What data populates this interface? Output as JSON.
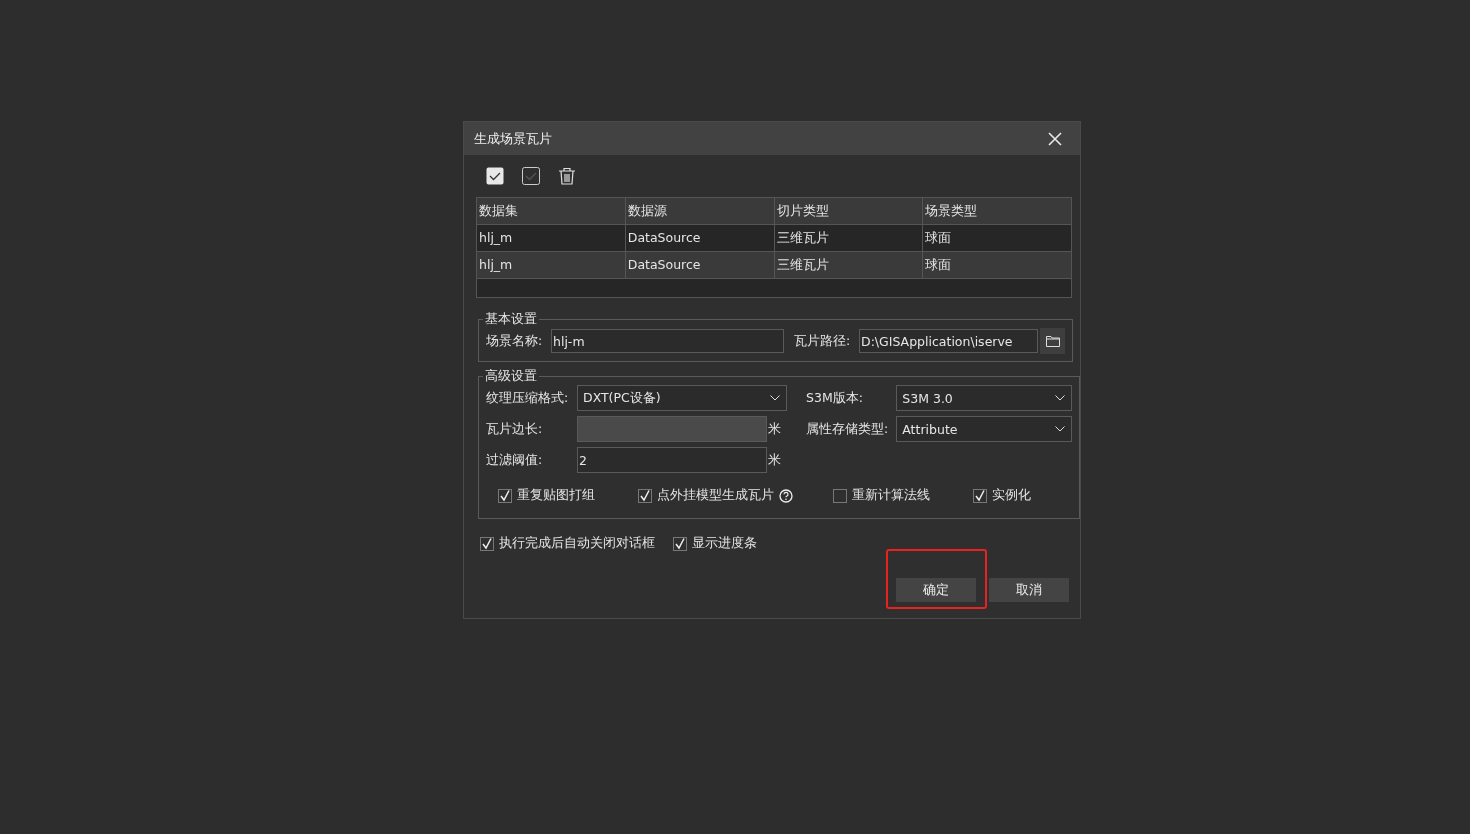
{
  "window": {
    "title": "生成场景瓦片"
  },
  "table": {
    "columns": [
      "数据集",
      "数据源",
      "切片类型",
      "场景类型"
    ],
    "rows": [
      [
        "hlj_m",
        "DataSource",
        "三维瓦片",
        "球面"
      ],
      [
        "hlj_m",
        "DataSource",
        "三维瓦片",
        "球面"
      ]
    ]
  },
  "basic_settings": {
    "legend": "基本设置",
    "scene_name": {
      "label": "场景名称:",
      "value": "hlj-m"
    },
    "tile_path": {
      "label": "瓦片路径:",
      "value": "D:\\GISApplication\\iserve"
    }
  },
  "advanced_settings": {
    "legend": "高级设置",
    "fields": [
      {
        "kind": "dropdown",
        "label": "纹理压缩格式:",
        "value": "DXT(PC设备)"
      },
      {
        "kind": "dropdown",
        "label": "S3M版本:",
        "value": "S3M 3.0"
      },
      {
        "kind": "input",
        "label": "瓦片边长:",
        "disabled": true,
        "unit": "米"
      },
      {
        "kind": "dropdown",
        "label": "属性存储类型:",
        "value": "Attribute"
      },
      {
        "kind": "input",
        "label": "过滤阈值:",
        "value": "2",
        "disabled": false,
        "unit": "米"
      }
    ],
    "options": [
      {
        "label": "重复贴图打组",
        "checked": true,
        "help": false
      },
      {
        "label": "点外挂模型生成瓦片",
        "checked": true,
        "help": true
      },
      {
        "label": "重新计算法线",
        "checked": false,
        "help": false
      },
      {
        "label": "实例化",
        "checked": true,
        "help": false
      }
    ]
  },
  "footer_options": [
    {
      "label": "执行完成后自动关闭对话框",
      "checked": true
    },
    {
      "label": "显示进度条",
      "checked": true
    }
  ],
  "buttons": [
    {
      "label": "确定",
      "highlighted": true
    },
    {
      "label": "取消",
      "highlighted": false
    }
  ]
}
